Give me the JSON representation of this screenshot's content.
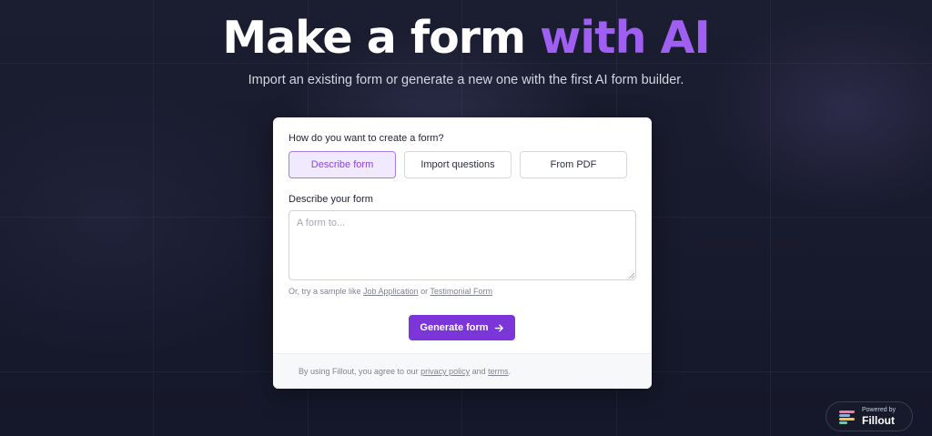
{
  "hero": {
    "title_plain": "Make a form ",
    "title_accent": "with AI",
    "subtitle": "Import an existing form or generate a new one with the first AI form builder."
  },
  "form_card": {
    "question": "How do you want to create a form?",
    "options": [
      {
        "label": "Describe form",
        "selected": true
      },
      {
        "label": "Import questions",
        "selected": false
      },
      {
        "label": "From PDF",
        "selected": false
      }
    ],
    "describe_label": "Describe your form",
    "textarea": {
      "placeholder": "A form to...",
      "value": ""
    },
    "sample_prefix": "Or, try a sample like ",
    "sample_link_1": "Job Application",
    "sample_or": " or ",
    "sample_link_2": "Testimonial Form",
    "generate_button": "Generate form",
    "generate_icon": "arrow-right-icon",
    "footer_prefix": "By using Fillout, you agree to our ",
    "footer_privacy": "privacy policy",
    "footer_and": " and ",
    "footer_terms": "terms",
    "footer_suffix": "."
  },
  "badge": {
    "small": "Powered by",
    "brand": "Fillout",
    "logo_icon": "fillout-logo-icon"
  },
  "colors": {
    "background": "#171a2b",
    "accent": "#9f5ff0",
    "button": "#7b35d9",
    "selected_bg": "#f1e9fd"
  }
}
